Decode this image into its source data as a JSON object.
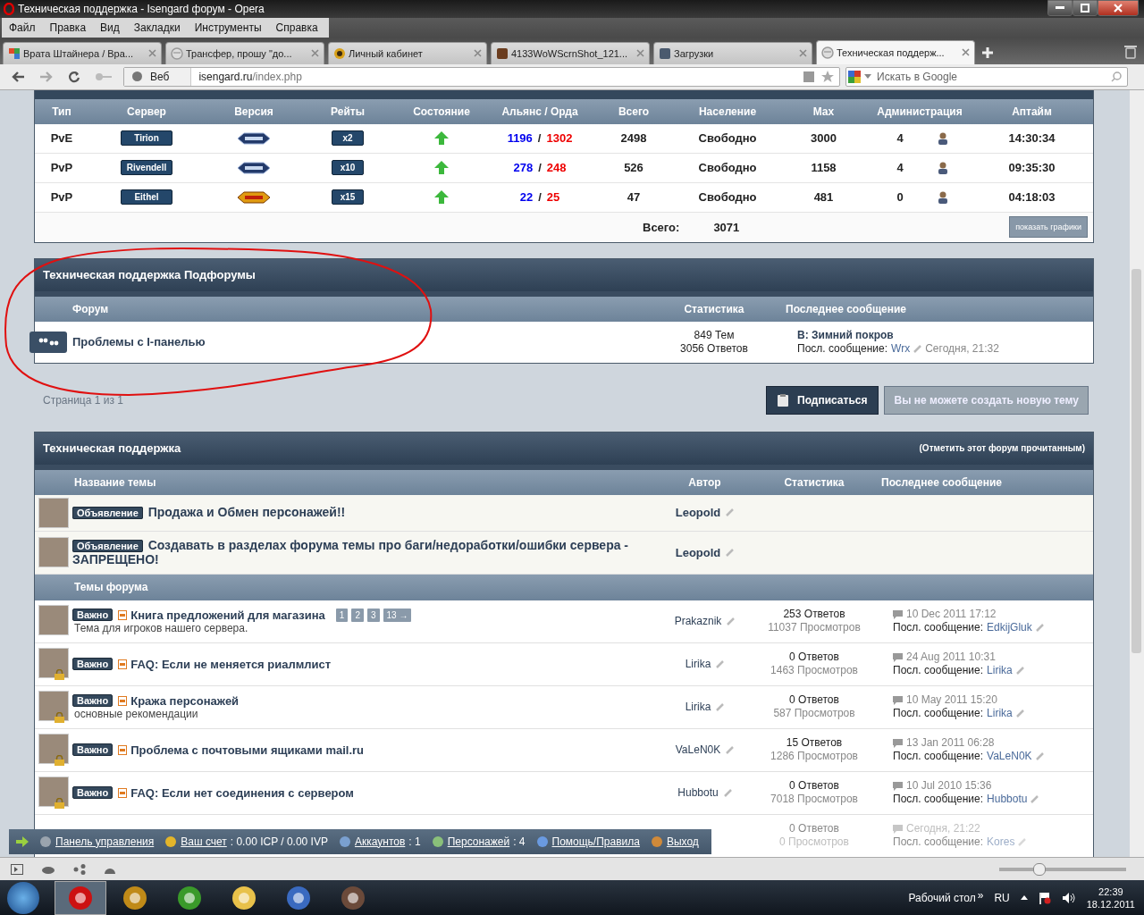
{
  "window": {
    "title": "Техническая поддержка - Isengard форум - Opera"
  },
  "menu": [
    "Файл",
    "Правка",
    "Вид",
    "Закладки",
    "Инструменты",
    "Справка"
  ],
  "tabs": [
    {
      "label": "Врата Штайнера / Вра...",
      "kind": "colorful",
      "selected": false
    },
    {
      "label": "Трансфер, прошу \"до...",
      "kind": "globe",
      "selected": false
    },
    {
      "label": "Личный кабинет",
      "kind": "wow",
      "selected": false
    },
    {
      "label": "4133WoWScrnShot_121...",
      "kind": "image",
      "selected": false
    },
    {
      "label": "Загрузки",
      "kind": "download",
      "selected": false
    },
    {
      "label": "Техническая поддерж...",
      "kind": "globe",
      "selected": true
    }
  ],
  "address": {
    "zone": "Веб",
    "host": "isengard.ru",
    "path": "/index.php"
  },
  "search": {
    "placeholder": "Искать в Google"
  },
  "servers": {
    "columns": [
      "Тип",
      "Сервер",
      "Версия",
      "Рейты",
      "Состояние",
      "Альянс / Орда",
      "Всего",
      "Население",
      "Max",
      "Администрация",
      "Аптайм"
    ],
    "rows": [
      {
        "type": "PvE",
        "server": "Tirion",
        "kind": "wrath",
        "rate": "x2",
        "online": true,
        "alliance": "1196",
        "separator": "/",
        "horde": "1302",
        "total": "2498",
        "population": "Свободно",
        "max": "3000",
        "admins": "4",
        "uptime": "14:30:34"
      },
      {
        "type": "PvP",
        "server": "Rivendell",
        "kind": "wrath",
        "rate": "x10",
        "online": true,
        "alliance": "278",
        "separator": "/",
        "horde": "248",
        "total": "526",
        "population": "Свободно",
        "max": "1158",
        "admins": "4",
        "uptime": "09:35:30"
      },
      {
        "type": "PvP",
        "server": "Eithel",
        "kind": "cata",
        "rate": "x15",
        "online": true,
        "alliance": "22",
        "separator": "/",
        "horde": "25",
        "total": "47",
        "population": "Свободно",
        "max": "481",
        "admins": "0",
        "uptime": "04:18:03"
      }
    ],
    "total_label": "Всего:",
    "total": "3071",
    "graphs_button": "показать графики"
  },
  "subforums": {
    "title": "Техническая поддержка Подфорумы",
    "columns": [
      "Форум",
      "Статистика",
      "Последнее сообщение"
    ],
    "items": [
      {
        "name": "Проблемы с I-панелью",
        "topics": "849 Тем",
        "replies": "3056 Ответов",
        "last_title": "В: Зимний покров",
        "last_label": "Посл. сообщение:",
        "last_user": "Wrx",
        "last_time": "Сегодня, 21:32"
      }
    ]
  },
  "pagination": "Страница 1 из 1",
  "subscribe_button": "Подписаться",
  "new_topic_button": {
    "label": "Вы не можете создать новую тему",
    "disabled": true
  },
  "forum": {
    "title": "Техническая поддержка",
    "mark_read": "(Отметить этот форум прочитанным)",
    "columns": [
      "Название темы",
      "Автор",
      "Статистика",
      "Последнее сообщение"
    ],
    "announcements": [
      {
        "tag": "Объявление",
        "title": "Продажа и Обмен персонажей!!",
        "author": "Leopold"
      },
      {
        "tag": "Объявление",
        "title": "Создавать в разделах форума темы про баги/недоработки/ошибки сервера - ЗАПРЕЩЕНО!",
        "author": "Leopold"
      }
    ],
    "section": "Темы форума",
    "topics": [
      {
        "tag": "Важно",
        "title": "Книга предложений для магазина",
        "subtitle": "Тема для игроков нашего сервера.",
        "pages": [
          "1",
          "2",
          "3",
          "13 →"
        ],
        "author": "Prakaznik",
        "replies": "253 Ответов",
        "views": "11037 Просмотров",
        "date": "10 Dec 2011 17:12",
        "last_label": "Посл. сообщение:",
        "last_user": "EdkijGluk",
        "locked": false
      },
      {
        "tag": "Важно",
        "title": "FAQ: Если не меняется риалмлист",
        "author": "Lirika",
        "replies": "0 Ответов",
        "views": "1463 Просмотров",
        "date": "24 Aug 2011 10:31",
        "last_label": "Посл. сообщение:",
        "last_user": "Lirika",
        "locked": true
      },
      {
        "tag": "Важно",
        "title": "Кража персонажей",
        "subtitle": "основные рекомендации",
        "author": "Lirika",
        "replies": "0 Ответов",
        "views": "587 Просмотров",
        "date": "10 May 2011 15:20",
        "last_label": "Посл. сообщение:",
        "last_user": "Lirika",
        "locked": true
      },
      {
        "tag": "Важно",
        "title": "Проблема с почтовыми ящиками mail.ru",
        "author": "VaLeN0K",
        "replies": "15 Ответов",
        "views": "1286 Просмотров",
        "date": "13 Jan 2011 06:28",
        "last_label": "Посл. сообщение:",
        "last_user": "VaLeN0K",
        "locked": true
      },
      {
        "tag": "Важно",
        "title": "FAQ: Если нет соединения с сервером",
        "author": "Hubbotu",
        "replies": "0 Ответов",
        "views": "7018 Просмотров",
        "date": "10 Jul 2010 15:36",
        "last_label": "Посл. сообщение:",
        "last_user": "Hubbotu",
        "locked": true
      },
      {
        "replies": "0 Ответов",
        "views": "0 Просмотров",
        "date": "Сегодня, 21:22",
        "last_label": "Посл. сообщение:",
        "last_user": "Kores"
      }
    ]
  },
  "toolbar": [
    {
      "kind": "settings",
      "link": "Панель управления"
    },
    {
      "kind": "coins",
      "link": "Ваш счет",
      "value": ": 0.00 ICP / 0.00 IVP"
    },
    {
      "kind": "user",
      "link": "Аккаунтов",
      "value": ": 1"
    },
    {
      "kind": "users",
      "link": "Персонажей",
      "value": ": 4"
    },
    {
      "kind": "help",
      "link": "Помощь/Правила"
    },
    {
      "kind": "exit",
      "link": "Выход"
    }
  ],
  "zoom_slider": {
    "level": 0.3
  },
  "taskbar": {
    "apps": [
      {
        "kind": "opera",
        "selected": true
      },
      {
        "kind": "wow",
        "selected": false
      },
      {
        "kind": "torrent",
        "selected": false
      },
      {
        "kind": "folder",
        "selected": false
      },
      {
        "kind": "media",
        "selected": false
      },
      {
        "kind": "game",
        "selected": false
      }
    ],
    "desktop": "Рабочий стол",
    "chevron": "»",
    "lang": "RU",
    "time": "22:39",
    "date": "18.12.2011"
  }
}
